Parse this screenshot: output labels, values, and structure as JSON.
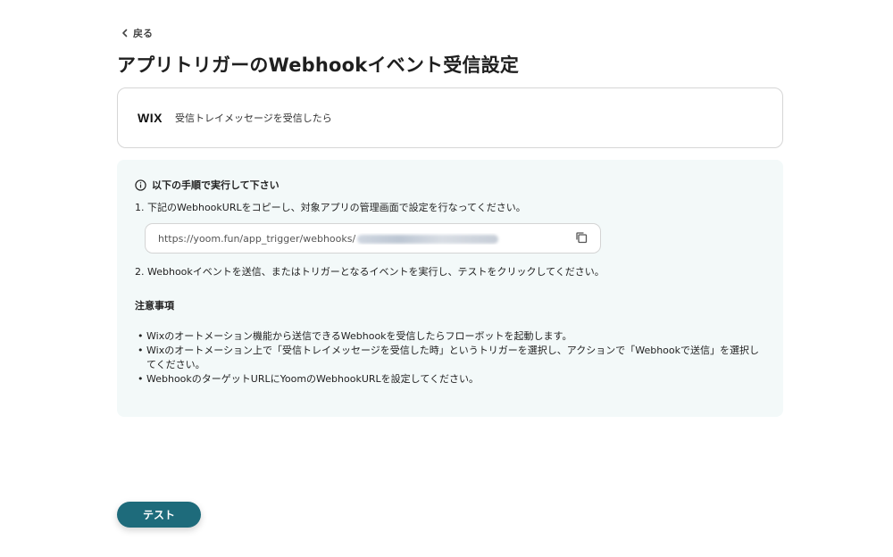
{
  "nav": {
    "back_label": "戻る"
  },
  "header": {
    "title": "アプリトリガーのWebhookイベント受信設定"
  },
  "app_card": {
    "logo_text": "WIX",
    "trigger_name": "受信トレイメッセージを受信したら"
  },
  "instructions": {
    "heading": "以下の手順で実行して下さい",
    "step1": "1. 下記のWebhookURLをコピーし、対象アプリの管理画面で設定を行なってください。",
    "webhook_url_prefix": "https://yoom.fun/app_trigger/webhooks/",
    "step2": "2. Webhookイベントを送信、またはトリガーとなるイベントを実行し、テストをクリックしてください。"
  },
  "notes": {
    "heading": "注意事項",
    "items": [
      "Wixのオートメーション機能から送信できるWebhookを受信したらフローボットを起動します。",
      "Wixのオートメーション上で「受信トレイメッセージを受信した時」というトリガーを選択し、アクションで「Webhookで送信」を選択してください。",
      "WebhookのターゲットURLにYoomのWebhookURLを設定してください。"
    ]
  },
  "footer": {
    "test_label": "テスト"
  },
  "colors": {
    "primary": "#1e6b7b",
    "panel_bg": "#f3f9f9",
    "border": "#d6d6d6"
  }
}
